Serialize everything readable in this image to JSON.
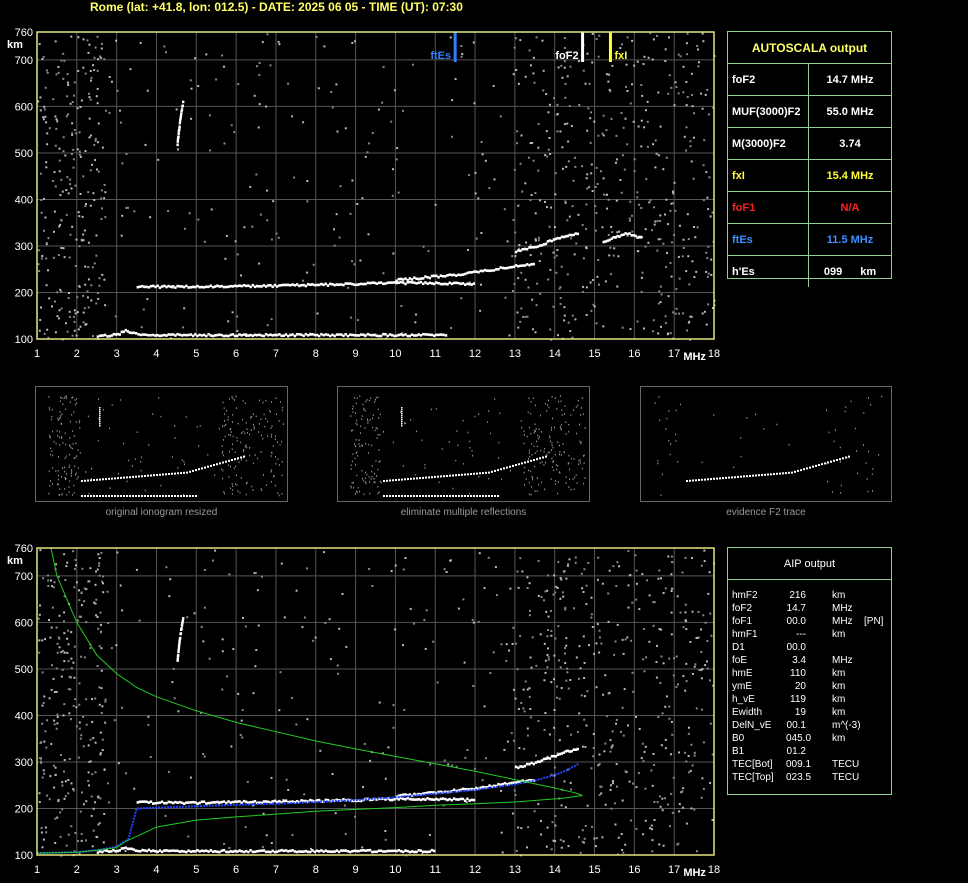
{
  "header": {
    "title": "Rome (lat: +41.8, lon: 012.5) - DATE: 2025 06 05 - TIME (UT): 07:30"
  },
  "axes": {
    "y_unit": "km",
    "x_unit": "MHz",
    "y_ticks": [
      100,
      200,
      300,
      400,
      500,
      600,
      700,
      760
    ],
    "x_ticks": [
      1,
      2,
      3,
      4,
      5,
      6,
      7,
      8,
      9,
      10,
      11,
      12,
      13,
      14,
      15,
      16,
      17,
      18
    ],
    "xlim": [
      1,
      18
    ],
    "ylim": [
      100,
      760
    ]
  },
  "chart_data": [
    {
      "type": "scatter",
      "xlabel": "MHz",
      "ylabel": "km",
      "xlim": [
        1,
        18
      ],
      "ylim": [
        100,
        760
      ],
      "grid": true,
      "markers": [
        {
          "label": "ftEs",
          "x": 11.5,
          "color": "#2f7fff"
        },
        {
          "label": "foF2",
          "x": 14.7,
          "color": "#ffffff"
        },
        {
          "label": "fxI",
          "x": 15.4,
          "color": "#ffff33"
        }
      ],
      "traces": [
        {
          "x": [
            2.5,
            2.8,
            3.0,
            3.1,
            3.2,
            3.4,
            3.7,
            4.0,
            5,
            6,
            7,
            8,
            9,
            10,
            11,
            11.3
          ],
          "y": [
            109,
            109,
            111,
            116,
            120,
            114,
            111,
            110,
            110,
            110,
            110,
            110,
            110,
            110,
            110,
            110
          ]
        },
        {
          "x": [
            3.5,
            4.0,
            5,
            6,
            7,
            8,
            9,
            10,
            11,
            12
          ],
          "y": [
            215,
            214,
            214,
            215,
            216,
            218,
            220,
            222,
            222,
            220
          ]
        },
        {
          "x": [
            10,
            10.5,
            11,
            11.5,
            12,
            12.5,
            13,
            13.5
          ],
          "y": [
            228,
            232,
            236,
            240,
            245,
            252,
            258,
            264
          ]
        },
        {
          "x": [
            13,
            13.5,
            14,
            14.3,
            14.6
          ],
          "y": [
            290,
            300,
            316,
            325,
            330
          ]
        },
        {
          "x": [
            15.2,
            15.5,
            15.8,
            16.2
          ],
          "y": [
            310,
            320,
            328,
            318
          ]
        },
        {
          "x": [
            4.5,
            4.55,
            4.6,
            4.65
          ],
          "y": [
            520,
            560,
            590,
            615
          ]
        }
      ]
    },
    {
      "type": "line",
      "xlabel": "MHz",
      "ylabel": "km",
      "xlim": [
        1,
        18
      ],
      "ylim": [
        100,
        760
      ],
      "grid": true,
      "series": [
        {
          "color": "#2244ff",
          "x": [
            1,
            2,
            2.5,
            3,
            3.3,
            3.5,
            4,
            5,
            6,
            7,
            8,
            9,
            10,
            11,
            12,
            12.5,
            13,
            13.5,
            14,
            14.3,
            14.6
          ],
          "y": [
            104,
            106,
            110,
            118,
            135,
            200,
            202,
            205,
            208,
            210,
            214,
            218,
            224,
            232,
            240,
            246,
            252,
            260,
            272,
            282,
            296
          ]
        },
        {
          "color": "#22cc22",
          "x": [
            1.35,
            1.5,
            1.8,
            2,
            2.5,
            3,
            3.5,
            4,
            4.5,
            5,
            6,
            7,
            8,
            9,
            10,
            11,
            12,
            13,
            14,
            14.5,
            14.7
          ],
          "y": [
            760,
            700,
            640,
            600,
            530,
            490,
            460,
            440,
            425,
            410,
            385,
            365,
            345,
            328,
            312,
            296,
            280,
            262,
            244,
            234,
            228
          ]
        },
        {
          "color": "#22cc22",
          "x": [
            14.7,
            14.2,
            13,
            12,
            11,
            10,
            9,
            8,
            7,
            6,
            5,
            4,
            3.5,
            3.2,
            3.0,
            2.5,
            2,
            1
          ],
          "y": [
            228,
            222,
            214,
            210,
            207,
            202,
            198,
            194,
            188,
            182,
            175,
            160,
            140,
            128,
            116,
            110,
            106,
            104
          ]
        }
      ],
      "traces": [
        {
          "x": [
            2.5,
            3.0,
            3.2,
            3.4,
            4,
            5,
            6,
            7,
            8,
            9,
            10,
            11
          ],
          "y": [
            109,
            112,
            118,
            112,
            110,
            110,
            110,
            110,
            110,
            110,
            110,
            110
          ]
        },
        {
          "x": [
            3.5,
            4.0,
            5,
            6,
            7,
            8,
            9,
            10,
            11,
            12
          ],
          "y": [
            215,
            214,
            214,
            215,
            216,
            218,
            220,
            222,
            222,
            220
          ]
        },
        {
          "x": [
            10,
            11,
            12,
            12.5,
            13,
            13.5
          ],
          "y": [
            228,
            236,
            245,
            252,
            258,
            264
          ]
        },
        {
          "x": [
            13,
            13.5,
            14,
            14.3,
            14.6
          ],
          "y": [
            290,
            300,
            316,
            325,
            330
          ]
        },
        {
          "x": [
            4.5,
            4.55,
            4.6,
            4.65
          ],
          "y": [
            520,
            560,
            590,
            615
          ]
        }
      ]
    }
  ],
  "autoscala": {
    "title": "AUTOSCALA output",
    "rows": [
      {
        "key": "foF2",
        "value": "14.7 MHz",
        "color": "#ffffff"
      },
      {
        "key": "MUF(3000)F2",
        "value": "55.0 MHz",
        "color": "#ffffff"
      },
      {
        "key": "M(3000)F2",
        "value": "3.74",
        "color": "#ffffff"
      },
      {
        "key": "fxI",
        "value": "15.4 MHz",
        "color": "#ffff33"
      },
      {
        "key": "foF1",
        "value": "N/A",
        "color": "#ff2222"
      },
      {
        "key": "ftEs",
        "value": "11.5 MHz",
        "color": "#3f8fff"
      },
      {
        "key": "h'Es",
        "value": "099",
        "unit": "km",
        "color": "#ffffff"
      }
    ]
  },
  "thumbnails": [
    {
      "caption": "original ionogram resized"
    },
    {
      "caption": "eliminate multiple reflections"
    },
    {
      "caption": "evidence F2 trace"
    }
  ],
  "aip": {
    "title": "AIP output",
    "rows": [
      {
        "name": "hmF2",
        "value": "216",
        "unit": "km",
        "extra": ""
      },
      {
        "name": "foF2",
        "value": "14.7",
        "unit": "MHz",
        "extra": ""
      },
      {
        "name": "foF1",
        "value": "00.0",
        "unit": "MHz",
        "extra": "[PN]"
      },
      {
        "name": "hmF1",
        "value": "---",
        "unit": "km",
        "extra": ""
      },
      {
        "name": "D1",
        "value": "00.0",
        "unit": "",
        "extra": ""
      },
      {
        "name": "foE",
        "value": "3.4",
        "unit": "MHz",
        "extra": ""
      },
      {
        "name": "hmE",
        "value": "110",
        "unit": "km",
        "extra": ""
      },
      {
        "name": "ymE",
        "value": "20",
        "unit": "km",
        "extra": ""
      },
      {
        "name": "h_vE",
        "value": "119",
        "unit": "km",
        "extra": ""
      },
      {
        "name": "Ewidth",
        "value": "19",
        "unit": "km",
        "extra": ""
      },
      {
        "name": "DelN_vE",
        "value": "00.1",
        "unit": "m^(-3)",
        "extra": ""
      },
      {
        "name": "B0",
        "value": "045.0",
        "unit": "km",
        "extra": ""
      },
      {
        "name": "B1",
        "value": "01.2",
        "unit": "",
        "extra": ""
      },
      {
        "name": "TEC[Bot]",
        "value": "009.1",
        "unit": "TECU",
        "extra": ""
      },
      {
        "name": "TEC[Top]",
        "value": "023.5",
        "unit": "TECU",
        "extra": ""
      }
    ]
  }
}
